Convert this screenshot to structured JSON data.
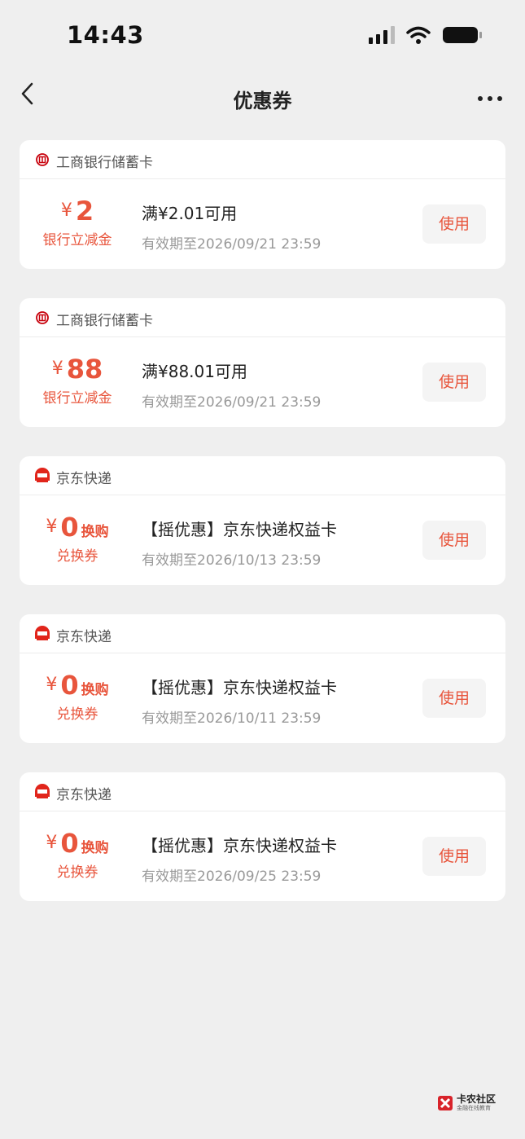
{
  "status_bar": {
    "time": "14:43"
  },
  "nav": {
    "title": "优惠券"
  },
  "coupons": [
    {
      "merchant": "工商银行储蓄卡",
      "merchant_icon": "icbc-logo-icon",
      "yen": "¥",
      "amount": "2",
      "tag": "",
      "label": "银行立减金",
      "condition": "满¥2.01可用",
      "expiry": "有效期至2026/09/21 23:59",
      "button": "使用"
    },
    {
      "merchant": "工商银行储蓄卡",
      "merchant_icon": "icbc-logo-icon",
      "yen": "¥",
      "amount": "88",
      "tag": "",
      "label": "银行立减金",
      "condition": "满¥88.01可用",
      "expiry": "有效期至2026/09/21 23:59",
      "button": "使用"
    },
    {
      "merchant": "京东快递",
      "merchant_icon": "jdl-logo-icon",
      "yen": "¥",
      "amount": "0",
      "tag": "换购",
      "label": "兑换券",
      "condition": "【摇优惠】京东快递权益卡",
      "expiry": "有效期至2026/10/13 23:59",
      "button": "使用"
    },
    {
      "merchant": "京东快递",
      "merchant_icon": "jdl-logo-icon",
      "yen": "¥",
      "amount": "0",
      "tag": "换购",
      "label": "兑换券",
      "condition": "【摇优惠】京东快递权益卡",
      "expiry": "有效期至2026/10/11 23:59",
      "button": "使用"
    },
    {
      "merchant": "京东快递",
      "merchant_icon": "jdl-logo-icon",
      "yen": "¥",
      "amount": "0",
      "tag": "换购",
      "label": "兑换券",
      "condition": "【摇优惠】京东快递权益卡",
      "expiry": "有效期至2026/09/25 23:59",
      "button": "使用"
    }
  ],
  "watermark": {
    "title": "卡农社区",
    "subtitle": "金融在线教育"
  },
  "colors": {
    "accent": "#e8553c",
    "background": "#efefef",
    "card": "#ffffff",
    "muted_text": "#999999"
  }
}
